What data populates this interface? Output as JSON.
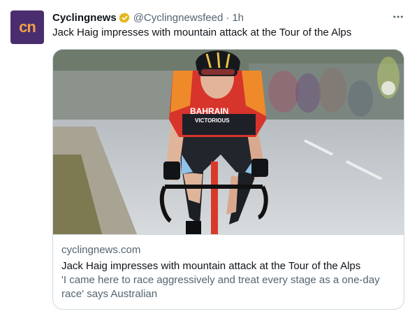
{
  "tweet": {
    "display_name": "Cyclingnews",
    "handle": "@Cyclingnewsfeed",
    "separator": "·",
    "time": "1h",
    "text": "Jack Haig impresses with mountain attack at the Tour of the Alps"
  },
  "avatar": {
    "text": "cn",
    "background": "#4a2d6e",
    "text_color": "#f0a24a"
  },
  "icons": {
    "verified": "verified-badge-icon",
    "more": "more-options-icon"
  },
  "colors": {
    "verified_gold": "#e2b719",
    "secondary_text": "#536471",
    "border": "#cfd9de"
  },
  "card": {
    "domain": "cyclingnews.com",
    "title": "Jack Haig impresses with mountain attack at the Tour of the Alps",
    "description_line1": "'I came here to race aggressively and treat every stage as a one-day",
    "description_line2": "race' says Australian",
    "jersey_brand": "BAHRAIN",
    "jersey_sub": "VICTORIOUS"
  }
}
